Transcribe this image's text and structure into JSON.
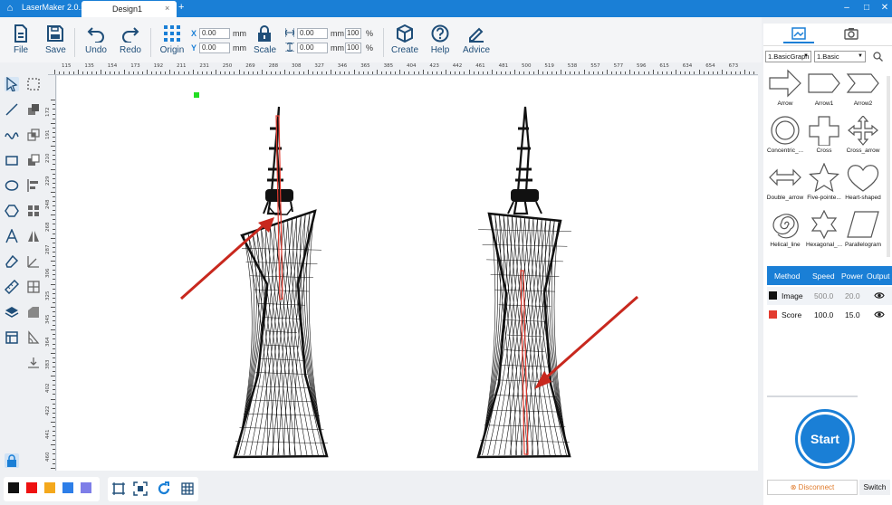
{
  "titlebar": {
    "app_title": "LaserMaker 2.0.15",
    "tab_label": "Design1",
    "tab_close": "×",
    "new_tab": "+",
    "minimize": "–",
    "maximize": "□",
    "close": "✕"
  },
  "toolbar": {
    "file": "File",
    "save": "Save",
    "undo": "Undo",
    "redo": "Redo",
    "origin": "Origin",
    "scale": "Scale",
    "create": "Create",
    "help": "Help",
    "advice": "Advice",
    "x_label": "X",
    "y_label": "Y",
    "x_value": "0.00",
    "y_value": "0.00",
    "w_value": "0.00",
    "h_value": "0.00",
    "w_pct": "100",
    "h_pct": "100",
    "unit_mm": "mm",
    "unit_pct": "%"
  },
  "ruler": {
    "top": [
      "115",
      "135",
      "154",
      "173",
      "192",
      "211",
      "231",
      "250",
      "269",
      "288",
      "308",
      "327",
      "346",
      "365",
      "385",
      "404",
      "423",
      "442",
      "461",
      "481",
      "500",
      "519",
      "538",
      "557",
      "577",
      "596",
      "615",
      "634",
      "654",
      "673"
    ],
    "left": [
      "172",
      "191",
      "210",
      "229",
      "248",
      "268",
      "287",
      "306",
      "325",
      "345",
      "364",
      "383",
      "402",
      "422",
      "441",
      "460"
    ]
  },
  "colors": {
    "accent": "#1a7fd6",
    "image_layer": "#111111",
    "score_layer": "#e33b2f",
    "arrow_red": "#c8281e",
    "anchor_green": "#22dd22"
  },
  "bottom_swatches": [
    "#111111",
    "#ee1111",
    "#f4a81c",
    "#2d7ee8",
    "#7e7ee8"
  ],
  "right_panel": {
    "category_select": "1.BasicGraph",
    "subcategory_select": "1.Basic",
    "shapes": [
      {
        "label": "Arrow",
        "icon": "arrow-shape-icon"
      },
      {
        "label": "Arrow1",
        "icon": "arrow1-shape-icon"
      },
      {
        "label": "Arrow2",
        "icon": "arrow2-shape-icon"
      },
      {
        "label": "Concentric_...",
        "icon": "concentric-shape-icon"
      },
      {
        "label": "Cross",
        "icon": "cross-shape-icon"
      },
      {
        "label": "Cross_arrow",
        "icon": "cross-arrow-shape-icon"
      },
      {
        "label": "Double_arrow",
        "icon": "double-arrow-shape-icon"
      },
      {
        "label": "Five-pointe...",
        "icon": "five-pointed-star-icon"
      },
      {
        "label": "Heart-shaped",
        "icon": "heart-shape-icon"
      },
      {
        "label": "Helical_line",
        "icon": "helical-line-icon"
      },
      {
        "label": "Hexagonal_...",
        "icon": "hexagonal-star-icon"
      },
      {
        "label": "Parallelogram",
        "icon": "parallelogram-shape-icon"
      }
    ],
    "layers": {
      "headers": [
        "Method",
        "Speed",
        "Power",
        "Output"
      ],
      "rows": [
        {
          "method": "Image",
          "speed": "500.0",
          "power": "20.0",
          "color": "#111111"
        },
        {
          "method": "Score",
          "speed": "100.0",
          "power": "15.0",
          "color": "#e33b2f"
        }
      ]
    },
    "start": "Start",
    "disconnect": "Disconnect",
    "switch": "Switch"
  }
}
